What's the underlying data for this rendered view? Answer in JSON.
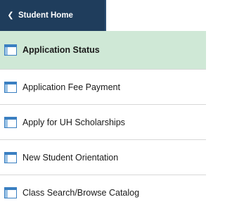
{
  "nav": {
    "back_label": "Student Home",
    "back_icon": "chevron-left-icon"
  },
  "menu": {
    "items": [
      {
        "label": "Application Status",
        "active": true,
        "icon": "page-layout-icon"
      },
      {
        "label": "Application Fee Payment",
        "active": false,
        "icon": "page-layout-icon"
      },
      {
        "label": "Apply for UH Scholarships",
        "active": false,
        "icon": "page-layout-icon"
      },
      {
        "label": "New Student Orientation",
        "active": false,
        "icon": "page-layout-icon"
      },
      {
        "label": "Class Search/Browse Catalog",
        "active": false,
        "icon": "page-layout-icon"
      }
    ]
  },
  "colors": {
    "header_bg": "#1f3d5c",
    "active_bg": "#cfe8d6",
    "icon_blue": "#3a7fc1"
  }
}
